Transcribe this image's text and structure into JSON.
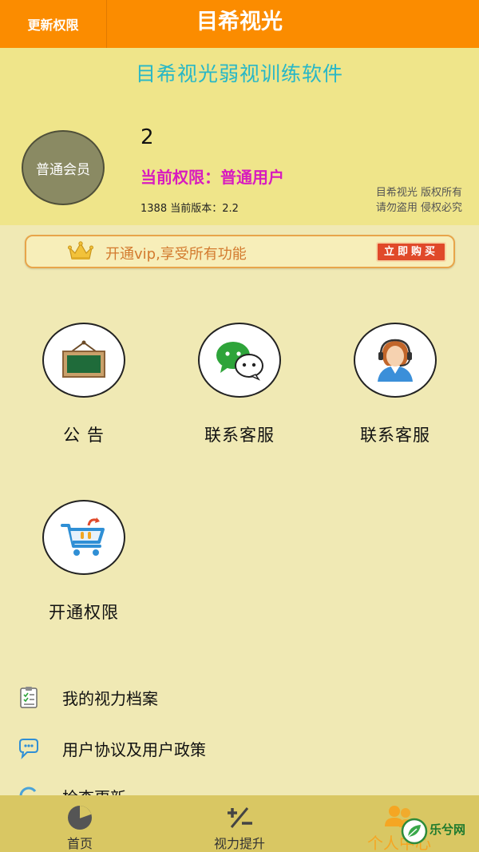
{
  "topbar": {
    "update_label": "更新权限",
    "title": "目希视光"
  },
  "header": {
    "subtitle": "目希视光弱视训练软件",
    "avatar_label": "普通会员",
    "user_name": "2",
    "permission": "当前权限：普通用户",
    "version_line": "1388  当前版本：2.2",
    "copyright_line1": "目希视光  版权所有",
    "copyright_line2": "请勿盗用  侵权必究"
  },
  "vip": {
    "text": "开通vip,享受所有功能",
    "buy_label": "立即购买"
  },
  "grid": [
    {
      "label": "公 告",
      "icon": "chalkboard-icon"
    },
    {
      "label": "联系客服",
      "icon": "wechat-icon"
    },
    {
      "label": "联系客服",
      "icon": "customer-service-icon"
    },
    {
      "label": "开通权限",
      "icon": "shopping-cart-icon"
    }
  ],
  "menu": [
    {
      "label": "我的视力档案",
      "icon": "clipboard-icon"
    },
    {
      "label": "用户协议及用户政策",
      "icon": "chat-bubble-icon"
    },
    {
      "label": "检查更新",
      "icon": "refresh-icon"
    }
  ],
  "bottom_nav": [
    {
      "label": "首页",
      "icon": "pie-chart-icon"
    },
    {
      "label": "视力提升",
      "icon": "plus-minus-icon"
    },
    {
      "label": "个人中心",
      "icon": "users-icon",
      "active": true
    }
  ],
  "watermark": {
    "text": "乐兮网"
  },
  "colors": {
    "topbar": "#fb8c00",
    "header_bg": "#efe58a",
    "page_bg": "#f0e9b4",
    "subtitle": "#27b7c7",
    "permission": "#d81bbf",
    "active_tab": "#f5a623",
    "bottom_nav": "#d9c763"
  }
}
